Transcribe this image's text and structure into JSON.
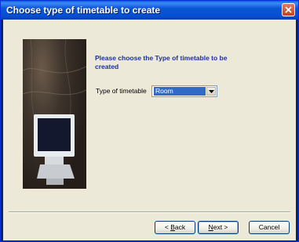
{
  "window": {
    "title": "Choose type of timetable to create"
  },
  "main": {
    "prompt": "Please choose the Type of timetable to be created",
    "field_label": "Type of timetable",
    "select_value": "Room"
  },
  "buttons": {
    "back_prefix": "< ",
    "back_key": "B",
    "back_rest": "ack",
    "next_key": "N",
    "next_rest": "ext >",
    "cancel": "Cancel"
  },
  "colors": {
    "title_bar": "#0553d2",
    "prompt_text": "#1c2fa0",
    "selection": "#316ac5",
    "close": "#d44a27"
  }
}
